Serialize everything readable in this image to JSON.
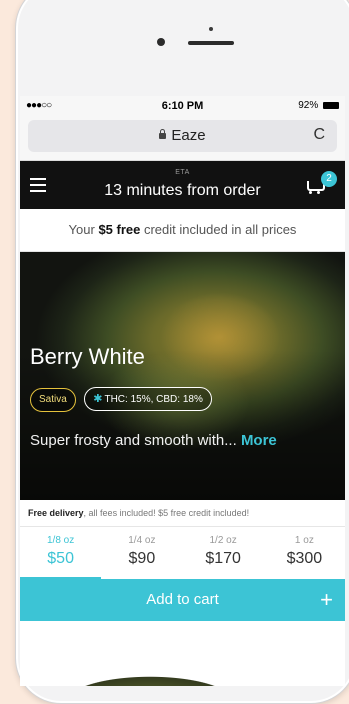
{
  "status": {
    "signal": "●●●○○",
    "time": "6:10 PM",
    "battery": "92%"
  },
  "browser": {
    "url": "Eaze"
  },
  "appbar": {
    "eta_label": "ETA",
    "eta": "13 minutes from order",
    "cart_count": "2"
  },
  "credit": {
    "prefix": "Your ",
    "amount": "$5 free",
    "suffix": " credit included in all prices"
  },
  "product": {
    "name": "Berry White",
    "type_tag": "Sativa",
    "potency_tag": "THC: 15%, CBD: 18%",
    "description": "Super frosty and smooth with...",
    "more_label": "More"
  },
  "delivery": {
    "bold": "Free delivery",
    "rest": ", all fees included! $5 free credit included!"
  },
  "prices": [
    {
      "weight": "1/8 oz",
      "price": "$50"
    },
    {
      "weight": "1/4 oz",
      "price": "$90"
    },
    {
      "weight": "1/2 oz",
      "price": "$170"
    },
    {
      "weight": "1 oz",
      "price": "$300"
    }
  ],
  "add_to_cart": {
    "label": "Add to cart",
    "plus": "+"
  },
  "colors": {
    "accent": "#3cc4d5",
    "background": "#fbe9dc",
    "header": "#111111",
    "sativa": "#e5c23c"
  }
}
